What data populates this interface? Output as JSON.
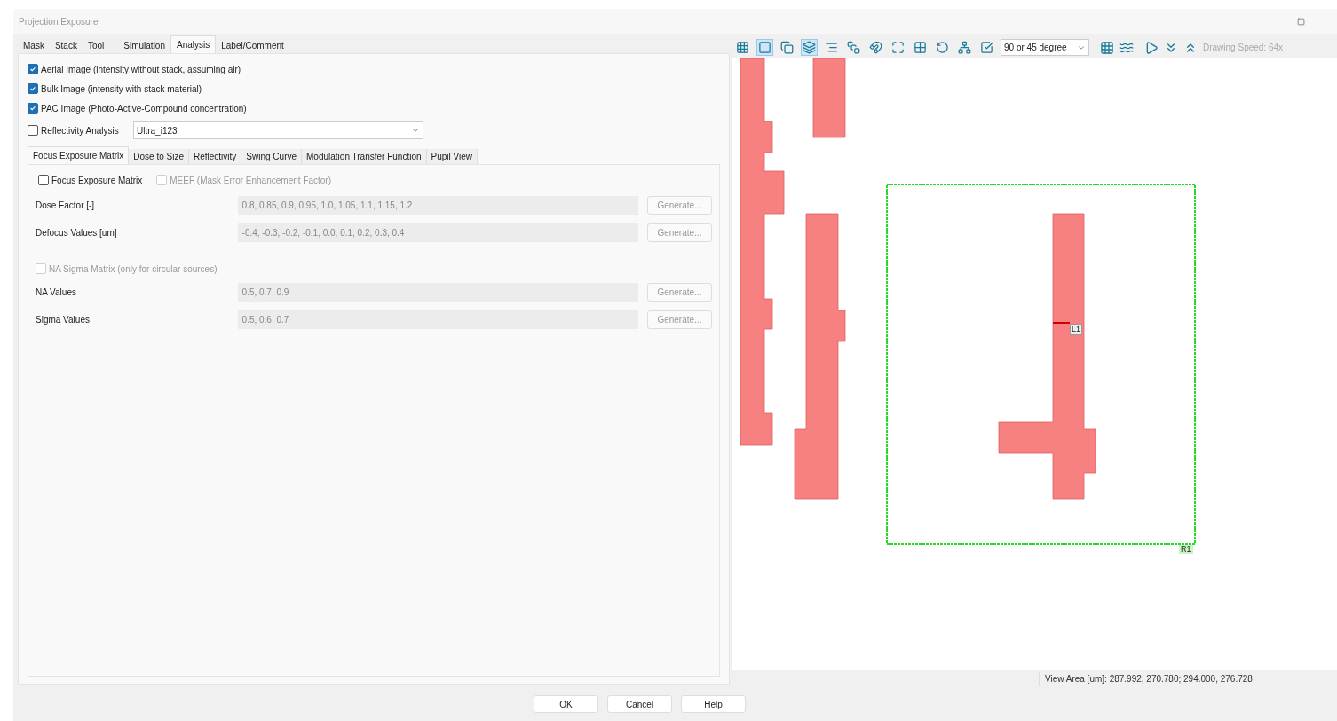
{
  "window": {
    "title": "Projection Exposure"
  },
  "tabs": [
    {
      "label": "Mask",
      "selected": false
    },
    {
      "label": "Stack",
      "selected": false
    },
    {
      "label": "Tool",
      "selected": false
    },
    {
      "label": "Simulation",
      "selected": false
    },
    {
      "label": "Analysis",
      "selected": true
    },
    {
      "label": "Label/Comment",
      "selected": false
    }
  ],
  "image_options": [
    {
      "label": "Aerial Image (intensity without stack, assuming air)",
      "checked": true
    },
    {
      "label": "Bulk Image (intensity with stack material)",
      "checked": true
    },
    {
      "label": "PAC Image (Photo-Active-Compound concentration)",
      "checked": true
    }
  ],
  "reflectivity": {
    "label": "Reflectivity Analysis",
    "checked": false,
    "value": "Ultra_i123"
  },
  "sub_tabs": [
    {
      "label": "Focus Exposure Matrix",
      "selected": true
    },
    {
      "label": "Dose to Size",
      "selected": false
    },
    {
      "label": "Reflectivity",
      "selected": false
    },
    {
      "label": "Swing Curve",
      "selected": false
    },
    {
      "label": "Modulation Transfer Function",
      "selected": false
    },
    {
      "label": "Pupil View",
      "selected": false
    }
  ],
  "fem_options": [
    {
      "label": "Focus Exposure Matrix",
      "checked": false,
      "disabled": false
    },
    {
      "label": "MEEF (Mask Error Enhancement Factor)",
      "checked": false,
      "disabled": true
    }
  ],
  "fem_rows": [
    {
      "label": "Dose Factor [-]",
      "value": "0.8, 0.85, 0.9, 0.95, 1.0, 1.05, 1.1, 1.15, 1.2",
      "button": "Generate...",
      "disabled": true
    },
    {
      "label": "Defocus Values [um]",
      "value": "-0.4, -0.3, -0.2, -0.1, 0.0, 0.1, 0.2, 0.3, 0.4",
      "button": "Generate...",
      "disabled": true
    }
  ],
  "na_sigma": {
    "label": "NA Sigma Matrix (only for circular sources)",
    "checked": false,
    "disabled": true
  },
  "na_rows": [
    {
      "label": "NA Values",
      "value": "0.5, 0.7, 0.9",
      "button": "Generate...",
      "disabled": true
    },
    {
      "label": "Sigma Values",
      "value": "0.5, 0.6, 0.7",
      "button": "Generate...",
      "disabled": true
    }
  ],
  "toolbar": {
    "tools": [
      {
        "selected": false
      },
      {
        "selected": true
      },
      {
        "selected": false
      },
      {
        "selected": true
      },
      {
        "selected": false
      },
      {
        "selected": false
      },
      {
        "selected": false
      },
      {
        "selected": false
      },
      {
        "selected": false
      },
      {
        "selected": false
      },
      {
        "selected": false
      },
      {
        "selected": false
      }
    ],
    "angle": "90 or 45 degree",
    "speed": "Drawing Speed: 64x"
  },
  "canvas": {
    "line_label": "L1",
    "region_label": "R1"
  },
  "status_bar": {
    "view_area": "View Area [um]: 287.992, 270.780; 294.000, 276.728"
  },
  "buttons": [
    "OK",
    "Cancel",
    "Help"
  ]
}
